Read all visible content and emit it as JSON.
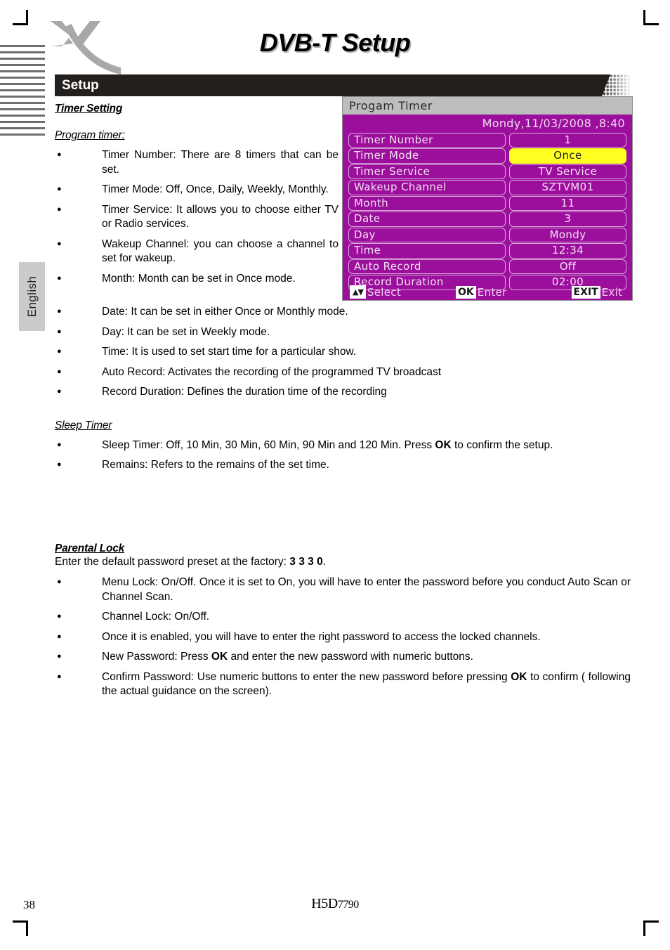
{
  "crop_marks": [
    "top-left",
    "top-right",
    "bottom-left",
    "bottom-right"
  ],
  "sidebar": {
    "language_tab": "English"
  },
  "header": {
    "logo_alt": "X",
    "page_title": "DVB-T Setup",
    "section_bar": "Setup"
  },
  "content": {
    "section1_heading": "Timer Setting",
    "program_timer_heading": "Program timer:",
    "program_timer_items": [
      "Timer Number: There are 8 timers that can be set.",
      "Timer Mode: Off, Once, Daily, Weekly, Monthly.",
      "Timer Service: It allows you to choose either TV or Radio services.",
      "Wakeup Channel: you can choose a channel to set for wakeup.",
      "Month: Month can be set in Once mode."
    ],
    "program_timer_items_wide": [
      "Date: It can be set in either Once or Monthly mode.",
      "Day: It can be set in Weekly mode.",
      "Time: It is used to set start time for a particular show.",
      "Auto Record: Activates the recording of the programmed TV broadcast",
      "Record Duration: Defines the duration time of the recording"
    ],
    "sleep_timer_heading": "Sleep Timer",
    "sleep_timer_items": [
      {
        "pre": "Sleep Timer: Off, 10 Min, 30 Min, 60 Min, 90 Min and 120 Min. Press ",
        "bold": "OK",
        "post": " to confirm the setup."
      },
      {
        "pre": "Remains: Refers to the remains of the set time.",
        "bold": "",
        "post": ""
      }
    ],
    "parental_lock_heading": "Parental Lock",
    "parental_lock_intro_pre": "Enter the default password preset at the factory: ",
    "parental_lock_intro_bold": "3 3 3 0",
    "parental_lock_intro_post": ".",
    "parental_lock_items": [
      {
        "pre": "Menu Lock: On/Off. Once it is set to On, you will have to enter the password before you conduct Auto Scan or Channel Scan.",
        "bold": "",
        "post": ""
      },
      {
        "pre": "Channel Lock: On/Off.",
        "bold": "",
        "post": ""
      },
      {
        "pre": "Once it is enabled, you will have to enter the right password to access the locked channels.",
        "bold": "",
        "post": ""
      },
      {
        "pre": "New Password: Press ",
        "bold": "OK",
        "post": " and enter the new password with numeric buttons."
      },
      {
        "pre": "Confirm Password: Use numeric buttons to enter the new password before pressing ",
        "bold": "OK",
        "post": " to confirm ( following the actual guidance on the screen)."
      }
    ]
  },
  "osd": {
    "title": "Progam Timer",
    "clock": "Mondy,11/03/2008 ,8:40",
    "colors": {
      "background": "#9c0f9c",
      "titlebar": "#bdbdbd",
      "highlight": "#ffff21",
      "text": "#f3e2f3"
    },
    "rows": [
      {
        "label": "Timer Number",
        "value": "1",
        "highlighted": false
      },
      {
        "label": "Timer Mode",
        "value": "Once",
        "highlighted": true
      },
      {
        "label": "Timer Service",
        "value": "TV Service",
        "highlighted": false
      },
      {
        "label": "Wakeup Channel",
        "value": "SZTVM01",
        "highlighted": false
      },
      {
        "label": "Month",
        "value": "11",
        "highlighted": false
      },
      {
        "label": "Date",
        "value": "3",
        "highlighted": false
      },
      {
        "label": "Day",
        "value": "Mondy",
        "highlighted": false
      },
      {
        "label": "Time",
        "value": "12:34",
        "highlighted": false
      },
      {
        "label": "Auto Record",
        "value": "Off",
        "highlighted": false
      },
      {
        "label": "Record Duration",
        "value": "02:00",
        "highlighted": false
      }
    ],
    "footer": {
      "select_key": "▲▼",
      "select_label": "Select",
      "ok_key": "OK",
      "ok_label": "Enter",
      "exit_key": "EXIT",
      "exit_label": "Exit"
    }
  },
  "footer": {
    "page_number": "38",
    "brand_primary": "H5D",
    "brand_model": "7790"
  }
}
